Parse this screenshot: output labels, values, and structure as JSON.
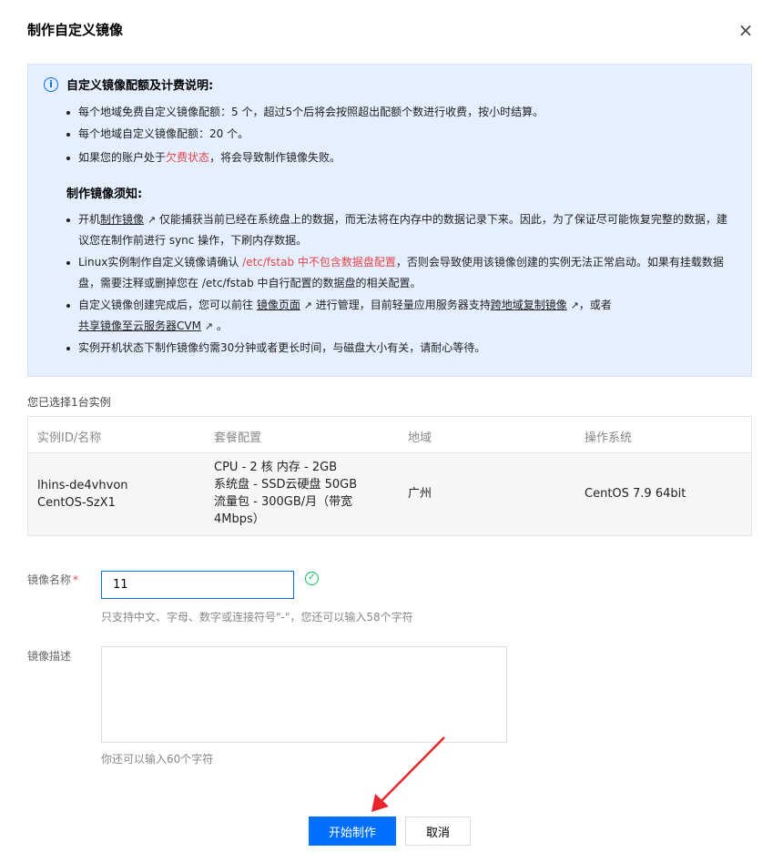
{
  "dialog": {
    "title": "制作自定义镜像",
    "close_glyph": "×"
  },
  "notice": {
    "quota_heading": "自定义镜像配额及计费说明:",
    "quota_items": [
      "每个地域免费自定义镜像配额：5 个，超过5个后将会按照超出配额个数进行收费，按小时结算。",
      "每个地域自定义镜像配额：20 个。"
    ],
    "arrears": {
      "before": "如果您的账户处于",
      "highlight": "欠费状态",
      "after": "，将会导致制作镜像失败。"
    },
    "make_heading": "制作镜像须知:",
    "item1": {
      "before": "开机",
      "link": "制作镜像",
      "after": "仅能捕获当前已经在系统盘上的数据，而无法将在内存中的数据记录下来。因此，为了保证尽可能恢复完整的数据，建议您在制作前进行 sync 操作，下刷内存数据。"
    },
    "item2": {
      "before": "Linux实例制作自定义镜像请确认 ",
      "highlight": "/etc/fstab 中不包含数据盘配置",
      "after": "，否则会导致使用该镜像创建的实例无法正常启动。如果有挂载数据盘，需要注释或删掉您在 /etc/fstab 中自行配置的数据盘的相关配置。"
    },
    "item3": {
      "before": "自定义镜像创建完成后，您可以前往 ",
      "link1": "镜像页面",
      "middle": " 进行管理，目前轻量应用服务器支持",
      "link2": "跨地域复制镜像",
      "middle2": "，或者",
      "link3": "共享镜像至云服务器CVM",
      "after": " 。"
    },
    "item4": "实例开机状态下制作镜像约需30分钟或者更长时间，与磁盘大小有关，请耐心等待。"
  },
  "selection": {
    "caption": "您已选择1台实例",
    "columns": [
      "实例ID/名称",
      "套餐配置",
      "地域",
      "操作系统"
    ],
    "row": {
      "id": "lhins-de4vhvon",
      "name": "CentOS-SzX1",
      "config": [
        "CPU - 2 核 内存 - 2GB",
        "系统盘 - SSD云硬盘 50GB",
        "流量包 - 300GB/月（带宽",
        "4Mbps）"
      ],
      "region": "广州",
      "os": "CentOS 7.9 64bit"
    }
  },
  "form": {
    "name_label": "镜像名称",
    "required_mark": "*",
    "name_value": "11",
    "name_hint": "只支持中文、字母、数字或连接符号\"-\"，您还可以输入58个字符",
    "desc_label": "镜像描述",
    "desc_hint": "你还可以输入60个字符"
  },
  "buttons": {
    "submit": "开始制作",
    "cancel": "取消"
  },
  "colors": {
    "primary": "#006eff",
    "notice_bg": "#e5efff",
    "warning": "#e54545",
    "success": "#0abf5b",
    "arrow": "#e8262c"
  }
}
